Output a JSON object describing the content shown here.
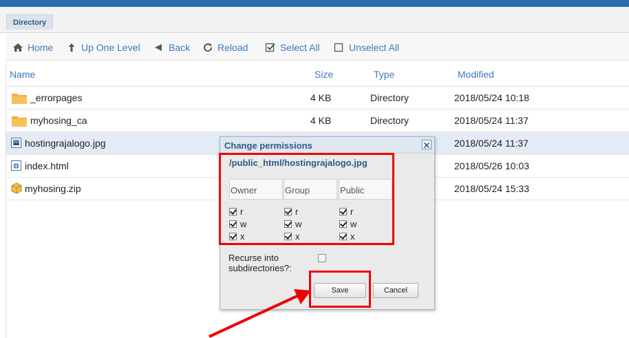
{
  "tabs": {
    "directory": "Directory"
  },
  "toolbar": {
    "home": "Home",
    "up_one_level": "Up One Level",
    "back": "Back",
    "reload": "Reload",
    "select_all": "Select All",
    "unselect_all": "Unselect All"
  },
  "table": {
    "columns": {
      "name": "Name",
      "size": "Size",
      "type": "Type",
      "modified": "Modified"
    },
    "rows": [
      {
        "name": "_errorpages",
        "size": "4 KB",
        "type": "Directory",
        "modified": "2018/05/24 10:18",
        "icon": "folder-icon"
      },
      {
        "name": "myhosing_ca",
        "size": "4 KB",
        "type": "Directory",
        "modified": "2018/05/24 11:37",
        "icon": "folder-icon"
      },
      {
        "name": "hostingrajalogo.jpg",
        "size": "",
        "type": "",
        "modified": "2018/05/24 11:37",
        "icon": "image-file-icon"
      },
      {
        "name": "index.html",
        "size": "",
        "type": "",
        "modified": "2018/05/26 10:03",
        "icon": "html-file-icon"
      },
      {
        "name": "myhosing.zip",
        "size": "",
        "type": "",
        "modified": "2018/05/24 15:33",
        "icon": "archive-file-icon"
      }
    ]
  },
  "dialog": {
    "title": "Change permissions",
    "path": "/public_html/hostingrajalogo.jpg",
    "headers": {
      "owner": "Owner",
      "group": "Group",
      "public": "Public"
    },
    "perm_labels": {
      "r": "r",
      "w": "w",
      "x": "x"
    },
    "permissions": {
      "owner": {
        "r": true,
        "w": true,
        "x": true
      },
      "group": {
        "r": true,
        "w": true,
        "x": true
      },
      "public": {
        "r": true,
        "w": true,
        "x": true
      }
    },
    "recurse_label_1": "Recurse into",
    "recurse_label_2": "subdirectories?:",
    "recurse_checked": false,
    "save": "Save",
    "cancel": "Cancel"
  },
  "colors": {
    "accent": "#3b78c0",
    "highlight": "#e00000",
    "folder": "#f0b041",
    "topbar": "#2a6db0"
  }
}
